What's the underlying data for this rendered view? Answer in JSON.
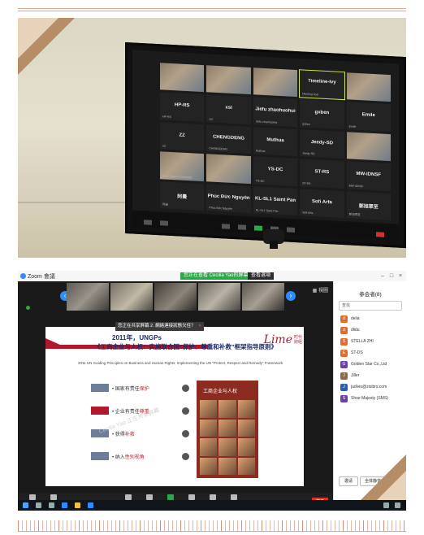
{
  "photo1": {
    "participants": [
      {
        "name": "",
        "sub": "",
        "video": true
      },
      {
        "name": "",
        "sub": "",
        "video": true
      },
      {
        "name": "",
        "sub": "",
        "video": true
      },
      {
        "name": "Timeline-Ivy",
        "sub": "Meeting host",
        "video": false,
        "active": true
      },
      {
        "name": "",
        "sub": "",
        "video": true
      },
      {
        "name": "HP-RS",
        "sub": "HP-RS",
        "video": false
      },
      {
        "name": "xsl",
        "sub": "xsl",
        "video": false
      },
      {
        "name": "Jiefu zhaohuohui",
        "sub": "Jiefu zhaohuohui",
        "video": false
      },
      {
        "name": "gxben",
        "sub": "gxben",
        "video": false
      },
      {
        "name": "Emile",
        "sub": "Emile",
        "video": false
      },
      {
        "name": "ZZ",
        "sub": "ZZ",
        "video": false
      },
      {
        "name": "CHENGDENG",
        "sub": "CHENGDENG",
        "video": false
      },
      {
        "name": "Muthua",
        "sub": "Muthua",
        "video": false
      },
      {
        "name": "Jeedy-SD",
        "sub": "Jeedy-SD",
        "video": false
      },
      {
        "name": "",
        "sub": "",
        "video": true
      },
      {
        "name": "",
        "sub": "Boat Yonas Crossroads",
        "video": true
      },
      {
        "name": "",
        "sub": "",
        "video": true
      },
      {
        "name": "YS-DC",
        "sub": "YS-DC",
        "video": false
      },
      {
        "name": "ST-RS",
        "sub": "ST-RS",
        "video": false
      },
      {
        "name": "MW-IDNSF",
        "sub": "MW-IDNSF",
        "video": false
      },
      {
        "name": "阿曼",
        "sub": "阿曼",
        "video": false
      },
      {
        "name": "Phúc Đức Nguyên",
        "sub": "Phúc Đức Nguyên",
        "video": false
      },
      {
        "name": "KL-SL1 Saint Pan",
        "sub": "KL-SL1 Saint Pan",
        "video": false
      },
      {
        "name": "Sofi Arfa",
        "sub": "Sofi Arfa",
        "video": false
      },
      {
        "name": "郭旭翠至",
        "sub": "郭旭翠至",
        "video": false
      }
    ]
  },
  "zoom": {
    "window_title": "Zoom 會議",
    "share_notice": "您正在查看 Cecilia Yao的屏幕",
    "view_options": "查看選項",
    "view_toggle": "▦ 視圖",
    "share_banner_text": "您正在共享屏幕 2. 網絡連接狀態欠佳？",
    "share_banner_stop": "×",
    "slide": {
      "title1": "2011年，UNGPs",
      "title2": "《工商企业与人权：实施联合国“保护、尊重和补救”框架指导原则》",
      "logo": "Lime",
      "logo_small": "时代财经",
      "subtitle": "2011 UN Guiding Principles on Business and Human Rights: Implementing the UN \"Protect, Respect and Remedy\" Framework",
      "items": [
        {
          "pre": "• 国家有责任",
          "hl": "保护",
          "color": "#6b7d97"
        },
        {
          "pre": "• 企业有责任",
          "hl": "尊重",
          "color": "#b0192b"
        },
        {
          "pre": "• 获得",
          "hl": "补救",
          "color": "#6b7d97"
        },
        {
          "pre": "• 纳入",
          "hl": "性别视角",
          "color": "#6b7d97"
        }
      ],
      "book_title": "工商企业与人权",
      "watermark": "Cecilia Yao 正在共享屏幕"
    },
    "toolbar": [
      {
        "label": "静音"
      },
      {
        "label": "开启视频"
      },
      {
        "label": "参会者"
      },
      {
        "label": "聊天"
      },
      {
        "label": "共享屏幕",
        "green": true
      },
      {
        "label": "录制"
      },
      {
        "label": "反应"
      },
      {
        "label": "应用"
      }
    ],
    "end_label": "离开",
    "panel": {
      "title": "参会者(8)",
      "search_placeholder": "查找",
      "participants": [
        {
          "initial": "d",
          "name": "delia",
          "color": "#e36c2d"
        },
        {
          "initial": "d",
          "name": "dlidu",
          "color": "#e36c2d"
        },
        {
          "initial": "S",
          "name": "STELLA ZHI",
          "color": "#e36c2d"
        },
        {
          "initial": "E",
          "name": "ST-DS",
          "color": "#e36c2d"
        },
        {
          "initial": "G",
          "name": "Golden Star Co.,Ltd",
          "color": "#6e3fa8"
        },
        {
          "initial": "J",
          "name": "Jiller",
          "color": "#8b6a4a"
        },
        {
          "initial": "J",
          "name": "judivio@zixibrs.com",
          "color": "#2c5fa8"
        },
        {
          "initial": "S",
          "name": "Shoe Majesty (SMS)",
          "color": "#6e3fa8"
        }
      ],
      "invite_label": "邀请",
      "mute_all_label": "全体静音"
    }
  }
}
